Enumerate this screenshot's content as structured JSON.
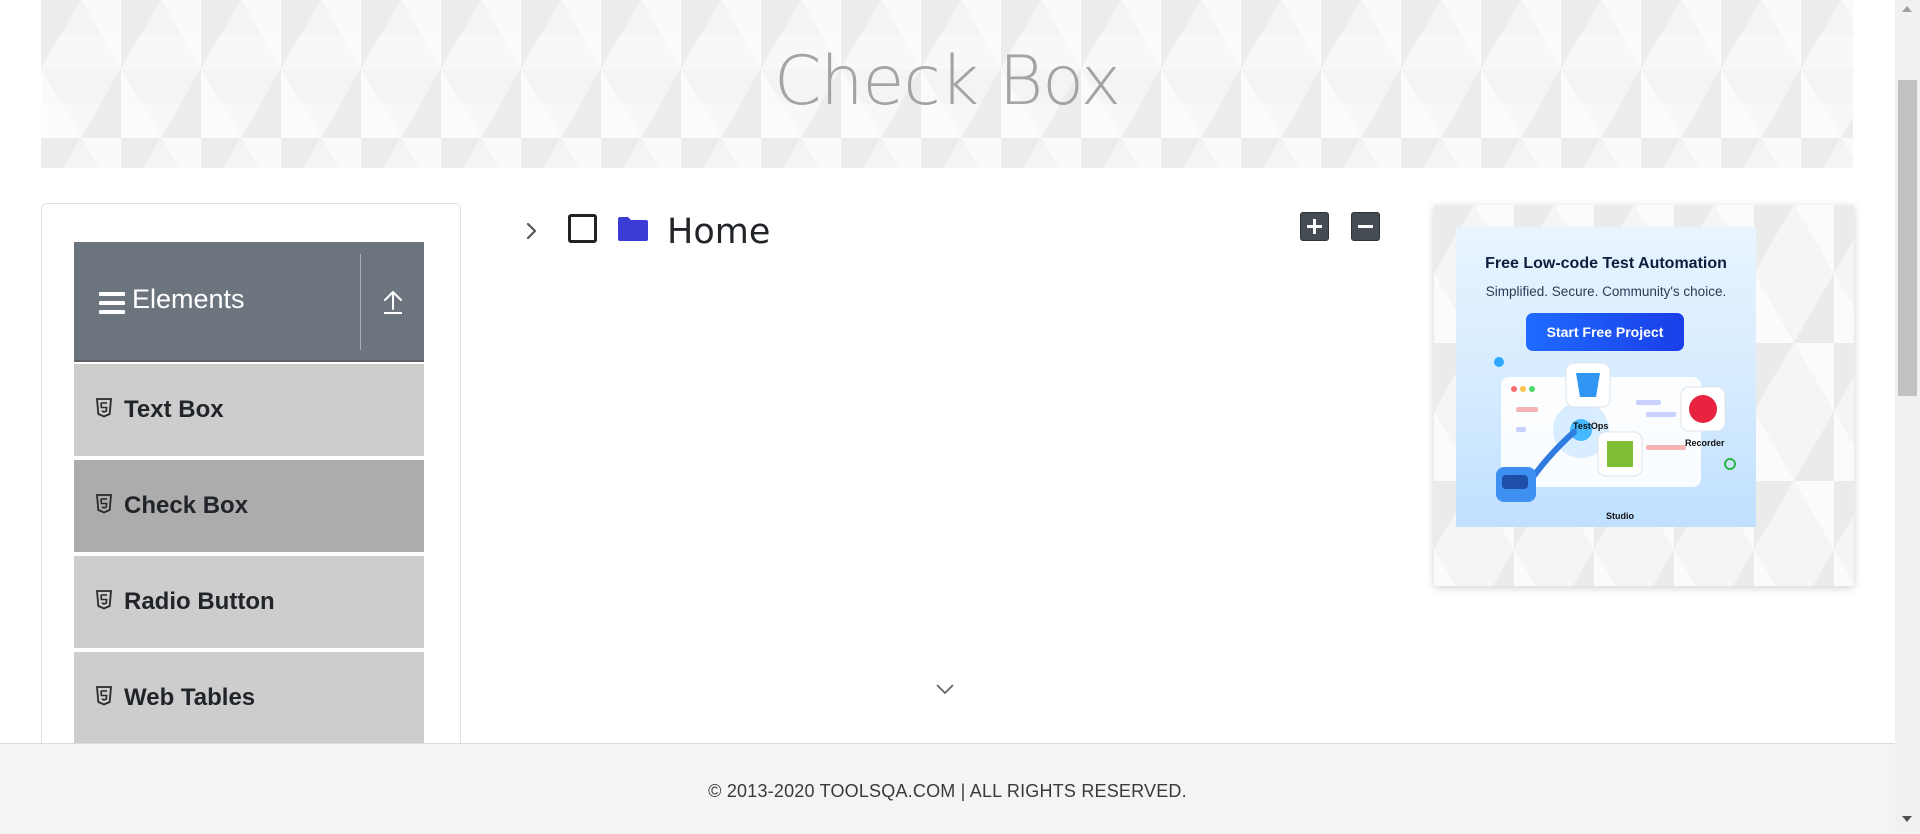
{
  "page": {
    "title": "Check Box"
  },
  "sidebar": {
    "group": {
      "label": "Elements",
      "icon": "hamburger-icon",
      "collapse_icon": "upload-icon"
    },
    "items": [
      {
        "label": "Text Box",
        "icon": "html5-icon",
        "active": false
      },
      {
        "label": "Check Box",
        "icon": "html5-icon",
        "active": true
      },
      {
        "label": "Radio Button",
        "icon": "html5-icon",
        "active": false
      },
      {
        "label": "Web Tables",
        "icon": "html5-icon",
        "active": false
      }
    ]
  },
  "tree": {
    "root": {
      "label": "Home",
      "checked": false,
      "expanded": false,
      "folder_color": "#3b3bd6"
    },
    "expand_all_icon": "plus-square-icon",
    "collapse_all_icon": "minus-square-icon"
  },
  "ad": {
    "headline": "Free Low-code Test Automation",
    "subline": "Simplified. Secure. Community's choice.",
    "cta": "Start Free Project",
    "products": [
      "TestOps",
      "Recorder",
      "Studio"
    ]
  },
  "footer": {
    "copyright": "© 2013-2020 TOOLSQA.COM | ALL RIGHTS RESERVED."
  },
  "colors": {
    "sidebar_header": "#6c757d",
    "menu_item": "#cdcdcd",
    "menu_item_active": "#acacac",
    "cta": "#1f6bff"
  }
}
